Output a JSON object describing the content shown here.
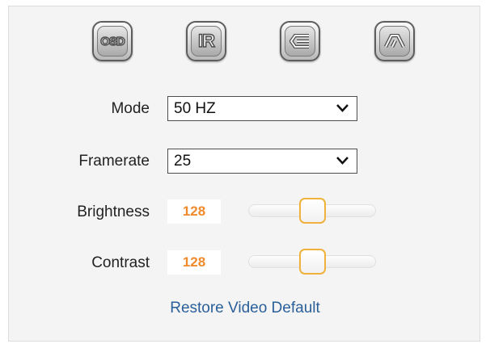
{
  "toolbar": {
    "buttons": [
      {
        "icon": "osd-icon",
        "text": "OSD"
      },
      {
        "icon": "ir-icon",
        "text": "IR"
      },
      {
        "icon": "flip-icon"
      },
      {
        "icon": "mirror-icon"
      }
    ]
  },
  "mode": {
    "label": "Mode",
    "value": "50 HZ"
  },
  "framerate": {
    "label": "Framerate",
    "value": "25"
  },
  "brightness": {
    "label": "Brightness",
    "value": "128",
    "level": 0.5
  },
  "contrast": {
    "label": "Contrast",
    "value": "128",
    "level": 0.5
  },
  "restore": {
    "label": "Restore Video Default"
  },
  "colors": {
    "value": "#f08a2a",
    "thumb_border": "#f0b23c",
    "link": "#2a5f9a"
  }
}
